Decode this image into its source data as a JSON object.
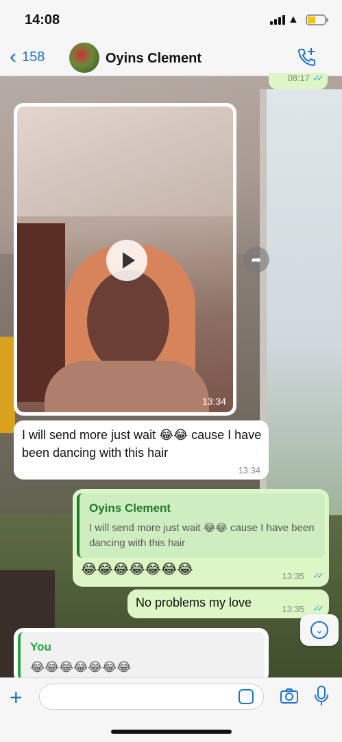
{
  "status_bar": {
    "time": "14:08"
  },
  "header": {
    "back_count": "158",
    "contact_name": "Oyins Clement",
    "icons": {
      "back": "chevron-left-icon",
      "call": "add-call-icon"
    }
  },
  "colors": {
    "accent": "#1a73c9",
    "outgoing_bubble": "#dcf7c5",
    "incoming_bubble": "#ffffff",
    "quote_name": "#1f7a2e"
  },
  "messages": {
    "stub": {
      "time": "08:17"
    },
    "video": {
      "time": "13:34",
      "icon": "play-icon"
    },
    "incoming_text": {
      "text": "I will send more just wait 😂😂 cause I have been dancing with this hair",
      "time": "13:34"
    },
    "reply": {
      "quoted_name": "Oyins Clement",
      "quoted_text": "I will send more just wait 😂😂 cause I have been dancing with this hair",
      "text": "😂😂😂😂😂😂😂",
      "time": "13:35"
    },
    "outgoing_text": {
      "text": "No problems my love",
      "time": "13:35"
    },
    "incoming_reply": {
      "quoted_name": "You",
      "quoted_text": "😂😂😂😂😂😂😂"
    }
  },
  "input": {
    "placeholder": ""
  }
}
